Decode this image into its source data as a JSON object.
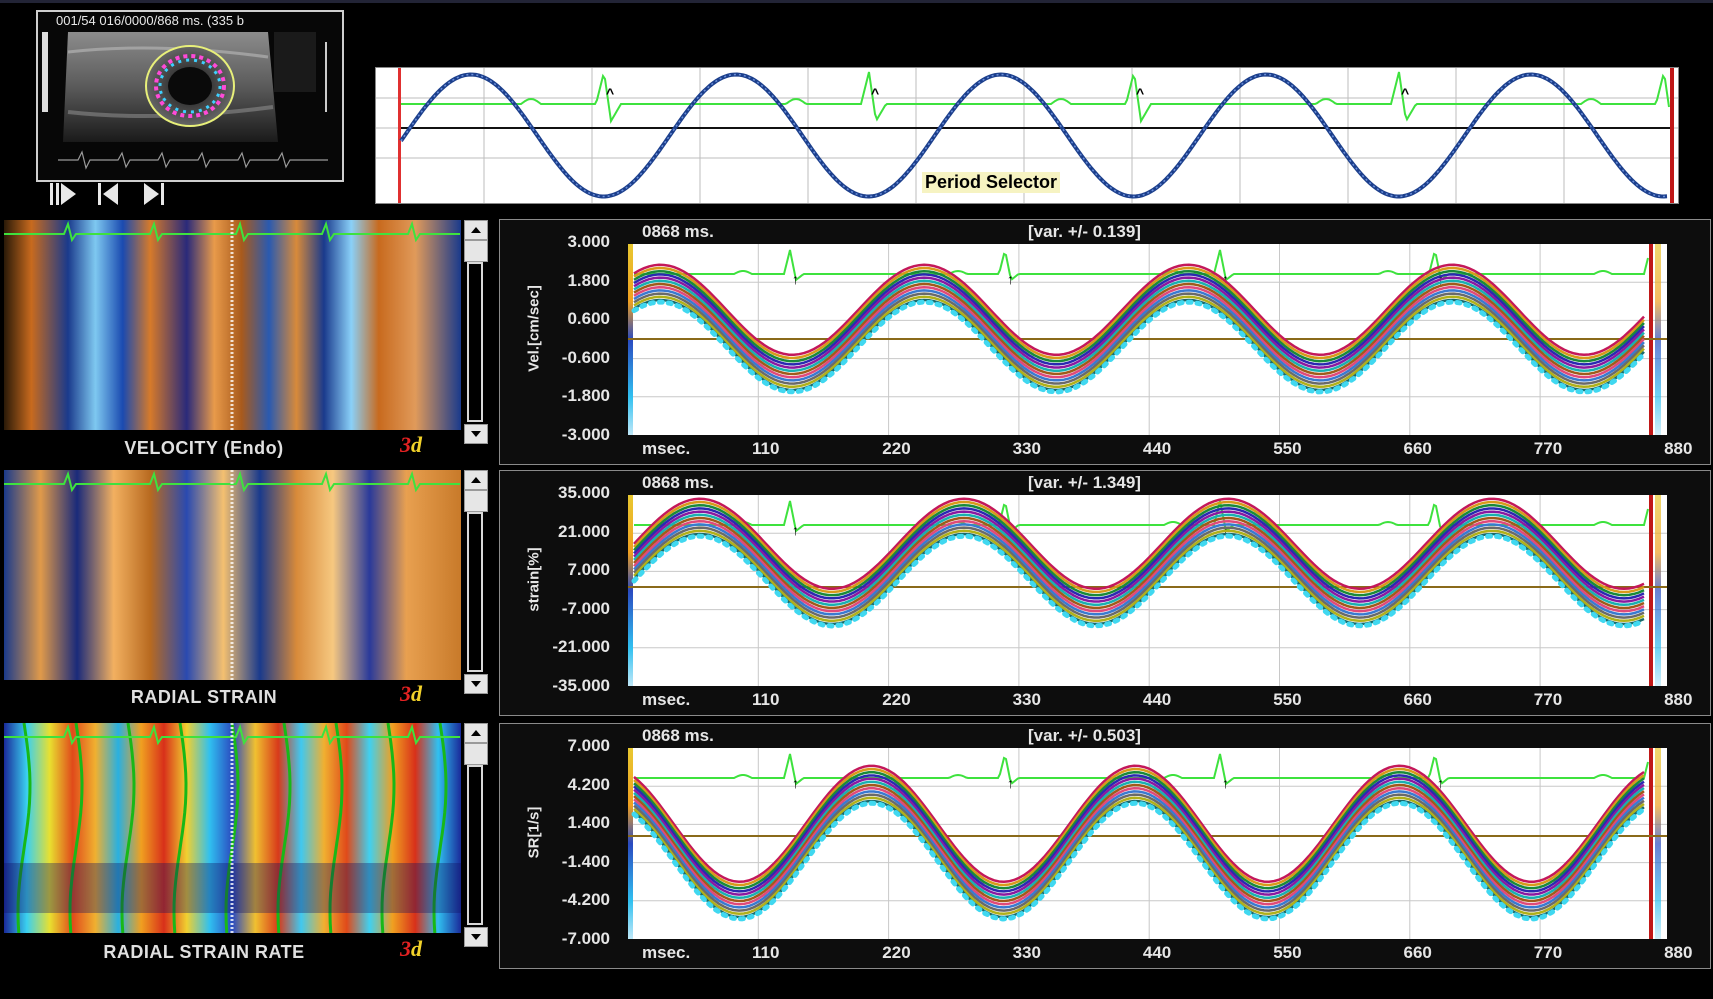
{
  "thumbnail": {
    "header": "001/54  016/0000/868 ms.  (335 b"
  },
  "controls": {
    "play_icon": "play-from-start-icon",
    "prev_icon": "step-back-icon",
    "next_icon": "step-forward-icon"
  },
  "period_selector": {
    "label": "Period Selector"
  },
  "strips": [
    {
      "label": "VELOCITY (Endo)",
      "logo": "3",
      "logo_suffix": "d"
    },
    {
      "label": "RADIAL STRAIN",
      "logo": "3",
      "logo_suffix": "d"
    },
    {
      "label": "RADIAL STRAIN RATE",
      "logo": "3",
      "logo_suffix": "d"
    }
  ],
  "panels": [
    {
      "time": "0868 ms.",
      "variance": "[var. +/- 0.139]",
      "ylabel": "Vel.[cm/sec]",
      "yticks": [
        "3.000",
        "1.800",
        "0.600",
        "-0.600",
        "-1.800",
        "-3.000"
      ],
      "xunit": "msec.",
      "xticks": [
        "110",
        "220",
        "330",
        "440",
        "550",
        "660",
        "770",
        "880"
      ]
    },
    {
      "time": "0868 ms.",
      "variance": "[var. +/- 1.349]",
      "ylabel": "strain[%]",
      "yticks": [
        "35.000",
        "21.000",
        "7.000",
        "-7.000",
        "-21.000",
        "-35.000"
      ],
      "xunit": "msec.",
      "xticks": [
        "110",
        "220",
        "330",
        "440",
        "550",
        "660",
        "770",
        "880"
      ]
    },
    {
      "time": "0868 ms.",
      "variance": "[var. +/- 0.503]",
      "ylabel": "SR[1/s]",
      "yticks": [
        "7.000",
        "4.200",
        "1.400",
        "-1.400",
        "-4.200",
        "-7.000"
      ],
      "xunit": "msec.",
      "xticks": [
        "110",
        "220",
        "330",
        "440",
        "550",
        "660",
        "770",
        "880"
      ]
    }
  ],
  "colors": {
    "ecg": "#3ee23e",
    "period_wave": "#1c3f8c",
    "baseline": "#8a6a1a",
    "marker_red": "#c01818"
  }
}
